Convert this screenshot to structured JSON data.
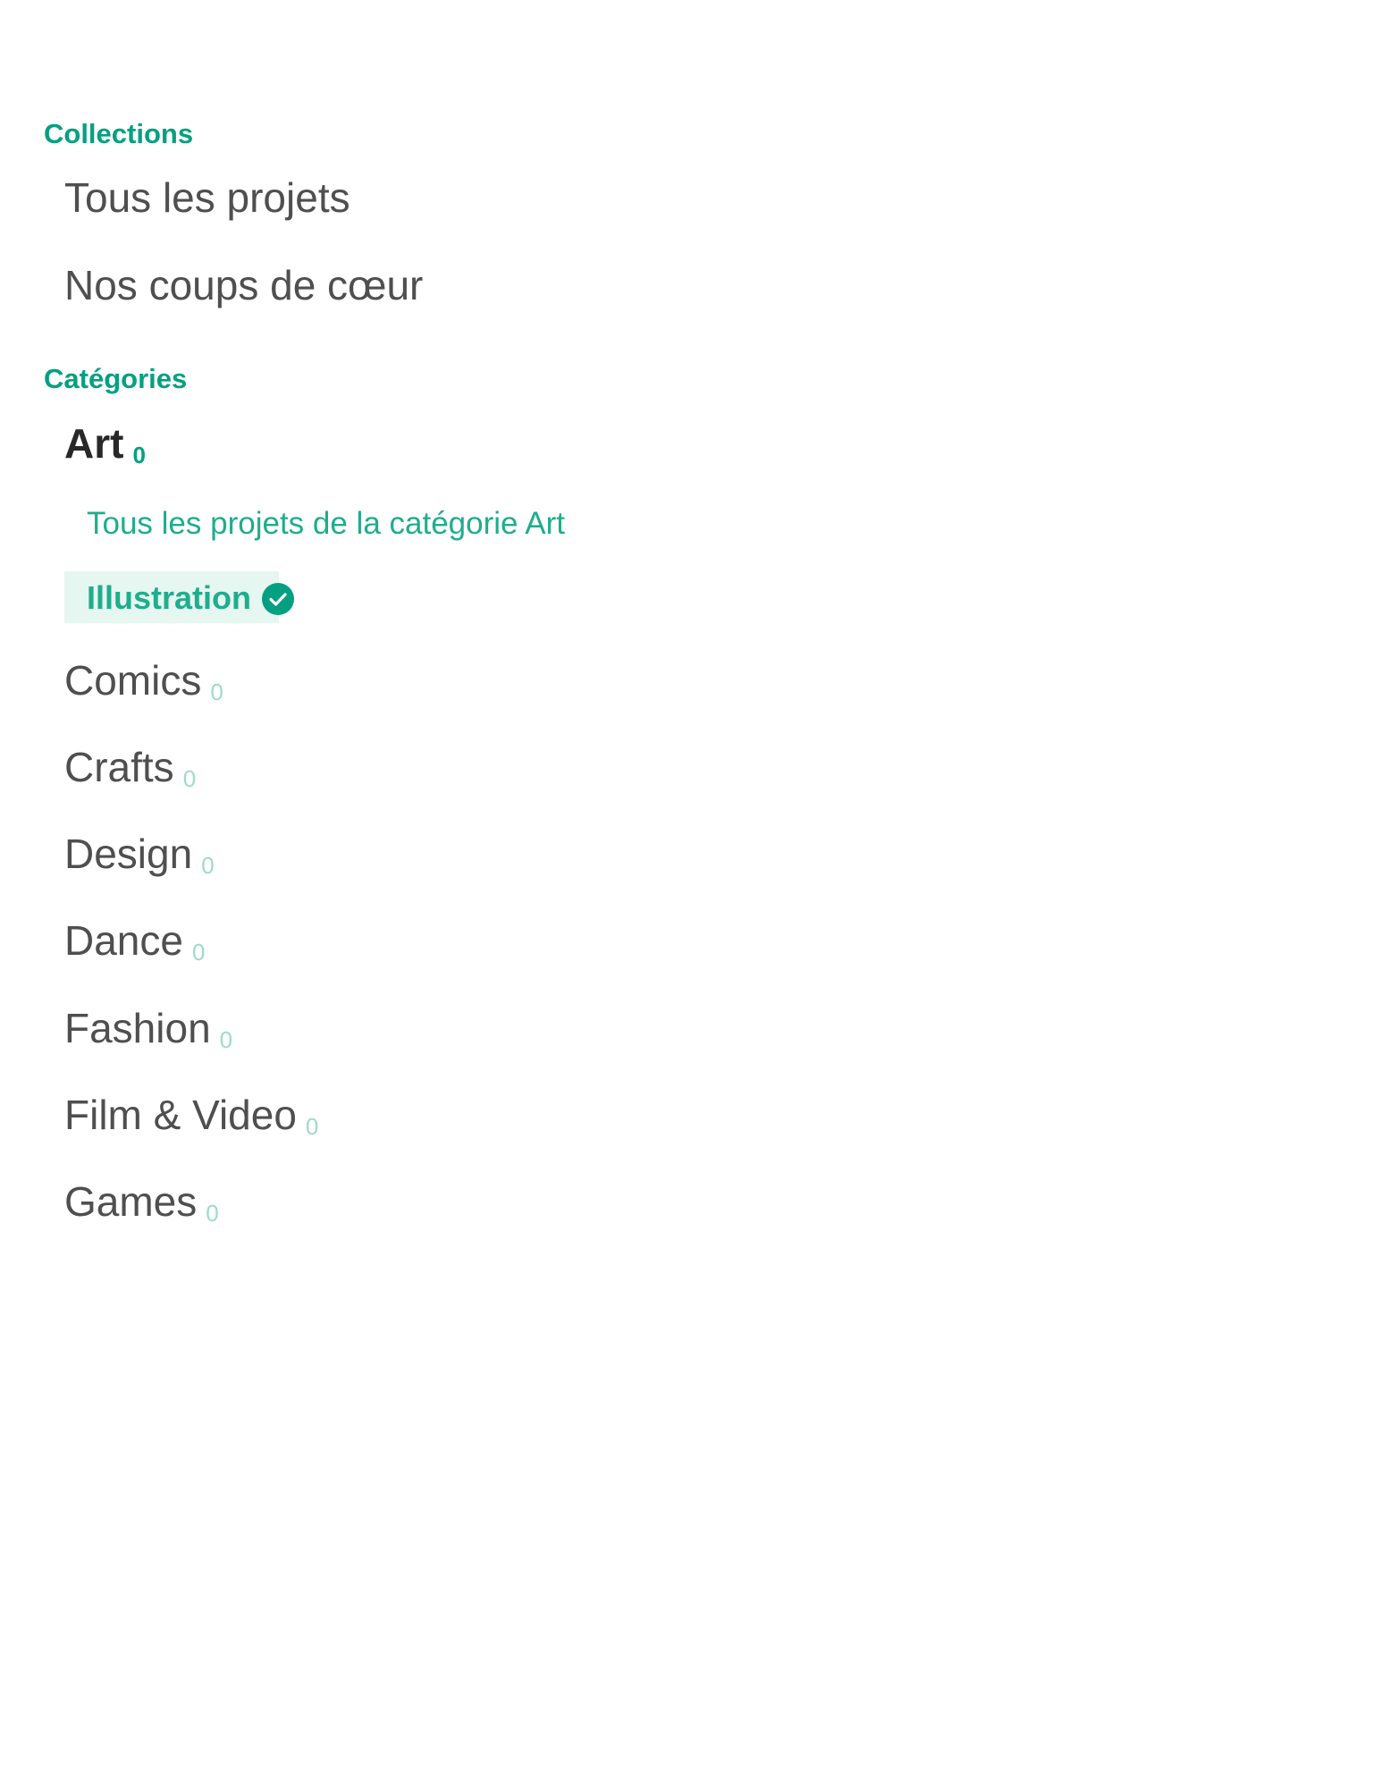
{
  "collections": {
    "heading": "Collections",
    "items": [
      {
        "label": "Tous les projets"
      },
      {
        "label": "Nos coups de cœur"
      }
    ]
  },
  "categories": {
    "heading": "Catégories",
    "parent": {
      "label": "Art",
      "count": "0"
    },
    "all_in_parent_label": "Tous les projets de la catégorie Art",
    "selected": {
      "label": "Illustration",
      "icon": "check-circle-icon"
    },
    "items": [
      {
        "label": "Comics",
        "count": "0"
      },
      {
        "label": "Crafts",
        "count": "0"
      },
      {
        "label": "Design",
        "count": "0"
      },
      {
        "label": "Dance",
        "count": "0"
      },
      {
        "label": "Fashion",
        "count": "0"
      },
      {
        "label": "Film & Video",
        "count": "0"
      },
      {
        "label": "Games",
        "count": "0"
      }
    ]
  },
  "colors": {
    "accent": "#05a081",
    "accent_light": "#1fad8d",
    "count_muted": "#9fdbc8",
    "selected_bg": "#e6f6f1",
    "text": "#4f4f4f",
    "text_strong": "#282828"
  }
}
